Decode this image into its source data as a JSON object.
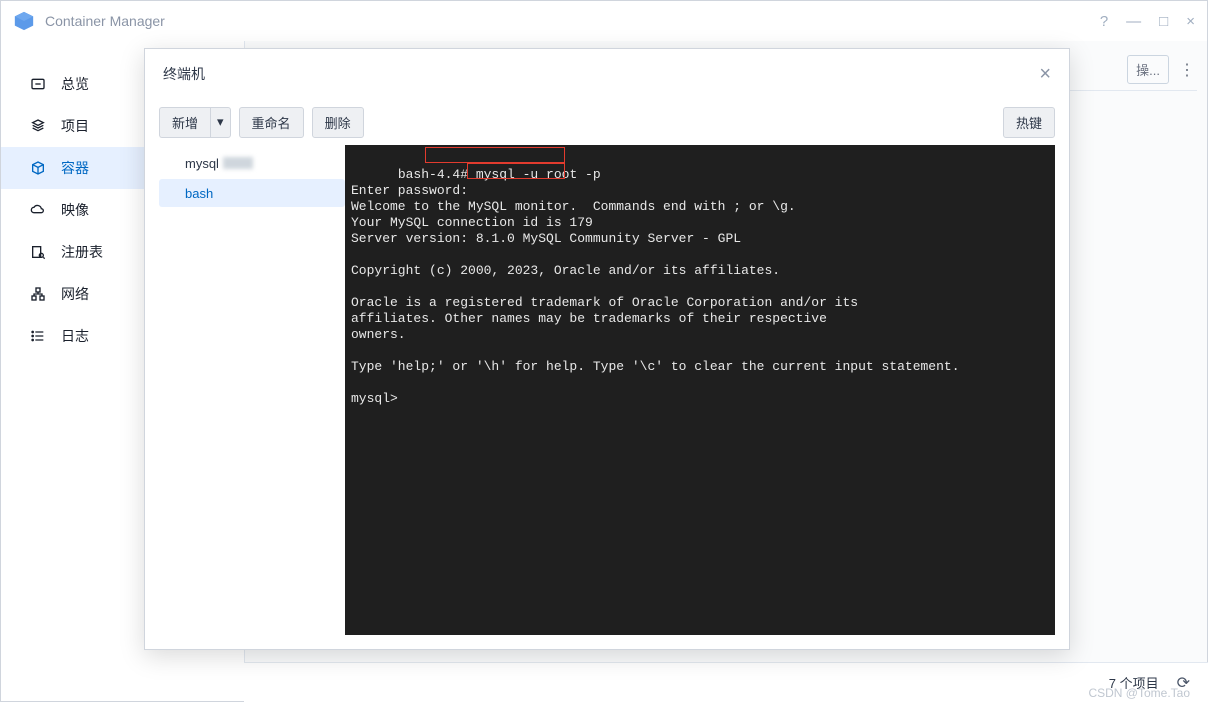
{
  "app": {
    "title": "Container Manager"
  },
  "windowControls": {
    "help": "?",
    "min": "—",
    "max": "□",
    "close": "×"
  },
  "sidebar": {
    "items": [
      {
        "label": "总览",
        "icon": "gauge"
      },
      {
        "label": "项目",
        "icon": "cube-stack"
      },
      {
        "label": "容器",
        "icon": "cube"
      },
      {
        "label": "映像",
        "icon": "cloud"
      },
      {
        "label": "注册表",
        "icon": "list-search"
      },
      {
        "label": "网络",
        "icon": "network"
      },
      {
        "label": "日志",
        "icon": "list"
      }
    ]
  },
  "content": {
    "opHeader": "操...",
    "footerCount": "7 个项目"
  },
  "modal": {
    "title": "终端机",
    "toolbar": {
      "new": "新增",
      "rename": "重命名",
      "delete": "删除",
      "hotkey": "热键"
    },
    "sessions": [
      {
        "label": "mysql"
      },
      {
        "label": "bash"
      }
    ],
    "terminal": {
      "text": "bash-4.4# mysql -u root -p\nEnter password:\nWelcome to the MySQL monitor.  Commands end with ; or \\g.\nYour MySQL connection id is 179\nServer version: 8.1.0 MySQL Community Server - GPL\n\nCopyright (c) 2000, 2023, Oracle and/or its affiliates.\n\nOracle is a registered trademark of Oracle Corporation and/or its\naffiliates. Other names may be trademarks of their respective\nowners.\n\nType 'help;' or '\\h' for help. Type '\\c' to clear the current input statement.\n\nmysql>"
    }
  },
  "watermark": "CSDN @Tome.Tao"
}
